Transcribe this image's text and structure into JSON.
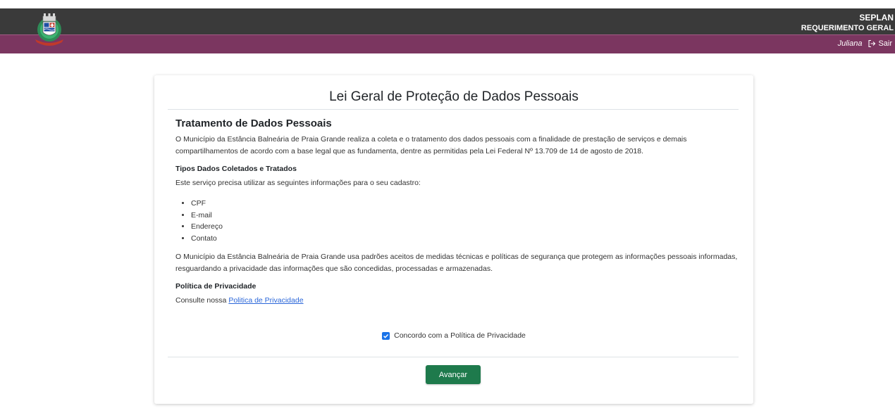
{
  "header": {
    "system_name": "SEPLAN",
    "module_name": "REQUERIMENTO GERAL",
    "user_name": "Juliana",
    "logout_label": "Sair",
    "colors": {
      "topbar": "#3a3a3a",
      "subbar": "#7b3660"
    }
  },
  "card": {
    "title": "Lei Geral de Proteção de Dados Pessoais",
    "section_title": "Tratamento de Dados Pessoais",
    "intro": "O Município da Estância Balneária de Praia Grande realiza a coleta e o tratamento dos dados pessoais com a finalidade de prestação de serviços e demais compartilhamentos de acordo com a base legal que as fundamenta, dentre as permitidas pela Lei Federal Nº 13.709 de 14 de agosto de 2018.",
    "types_title": "Tipos Dados Coletados e Tratados",
    "types_intro": "Este serviço precisa utilizar as seguintes informações para o seu cadastro:",
    "items": [
      "CPF",
      "E-mail",
      "Endereço",
      "Contato"
    ],
    "security_text": "O Município da Estância Balneária de Praia Grande usa padrões aceitos de medidas técnicas e políticas de segurança que protegem as informações pessoais informadas, resguardando a privacidade das informações que são concedidas, processadas e armazenadas.",
    "policy_title": "Política de Privacidade",
    "policy_text": "Consulte nossa",
    "policy_link": "Politica de Privacidade",
    "agree_label": "Concordo com a Política de Privacidade",
    "agree_checked": true,
    "next_button": "Avançar",
    "colors": {
      "button": "#1e7a4c",
      "link": "#2a66d9",
      "checkbox": "#1a73e8"
    }
  }
}
